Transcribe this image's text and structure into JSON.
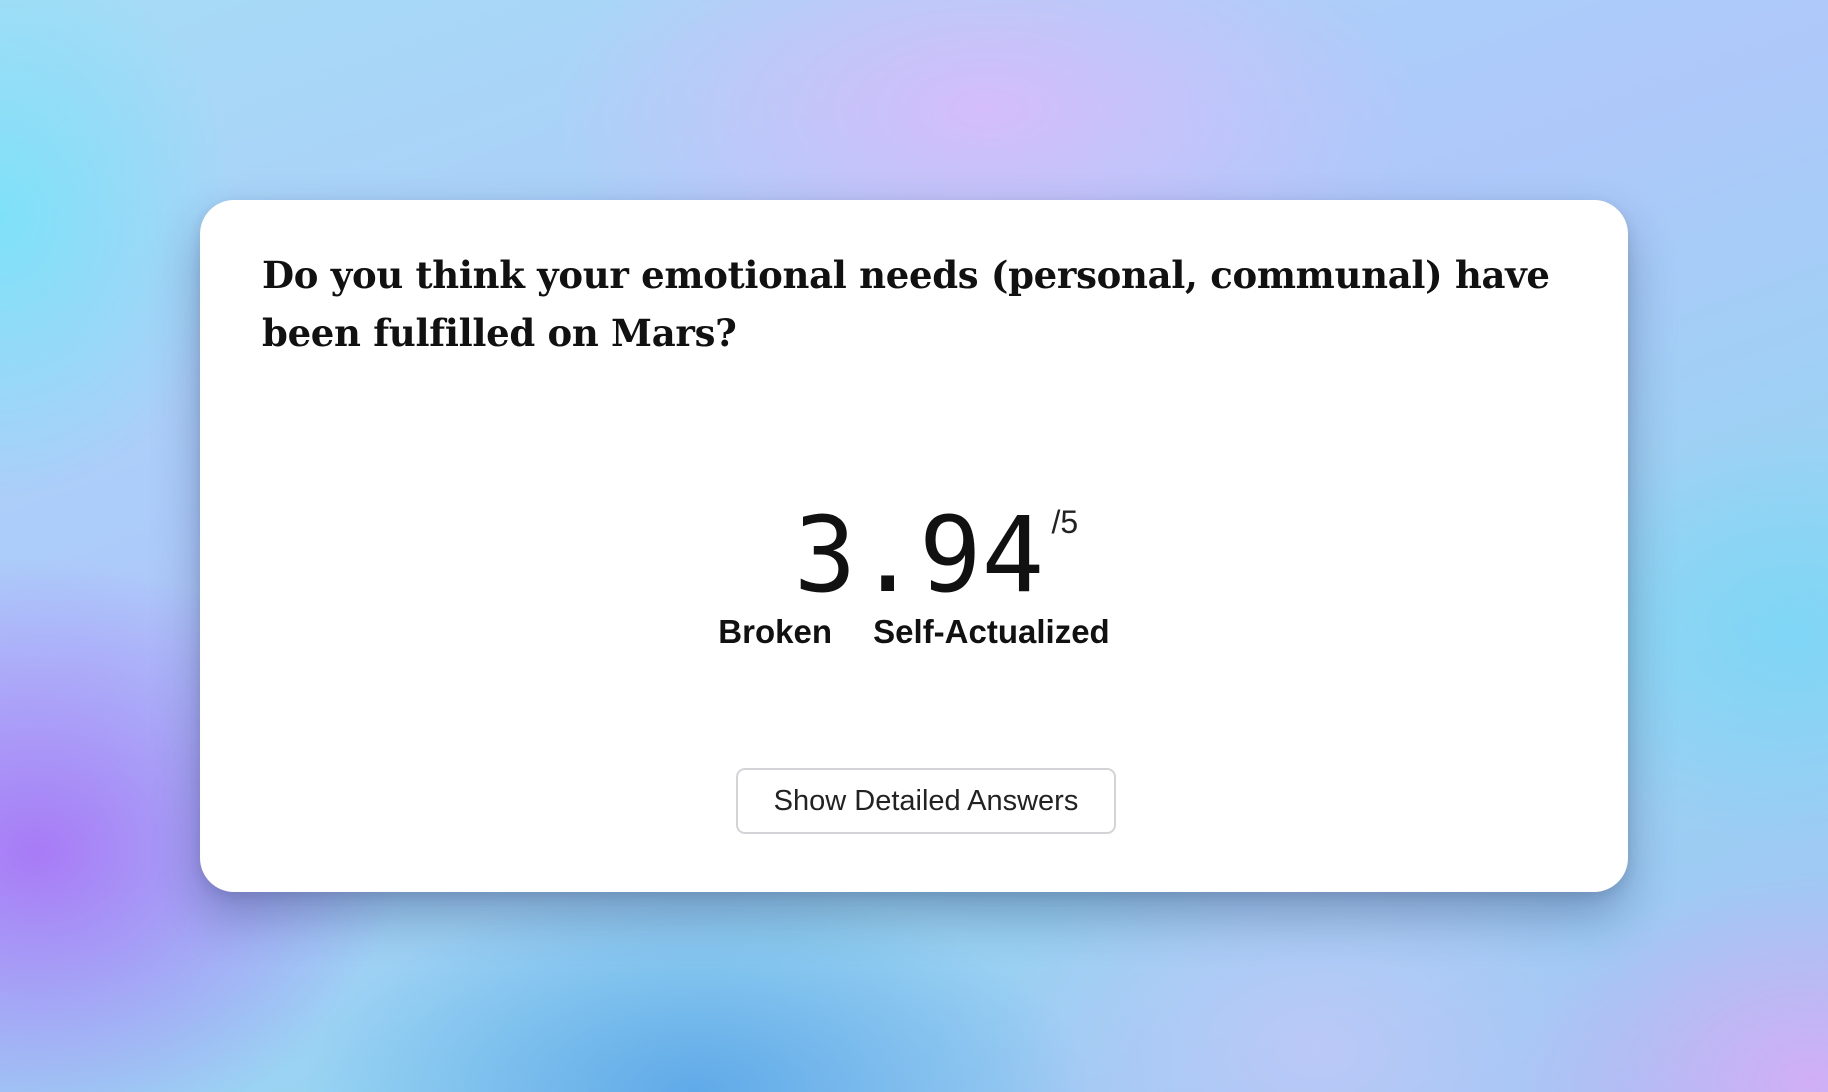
{
  "card": {
    "question": "Do you think your emotional needs (personal, communal) have been fulfilled on Mars?",
    "score": {
      "value": "3.94",
      "max_label": "/5"
    },
    "scale": {
      "low_label": "Broken",
      "high_label": "Self-Actualized"
    },
    "button_label": "Show Detailed Answers"
  },
  "colors": {
    "card_background": "#ffffff",
    "text": "#111111",
    "button_border": "#d4d4d8"
  }
}
